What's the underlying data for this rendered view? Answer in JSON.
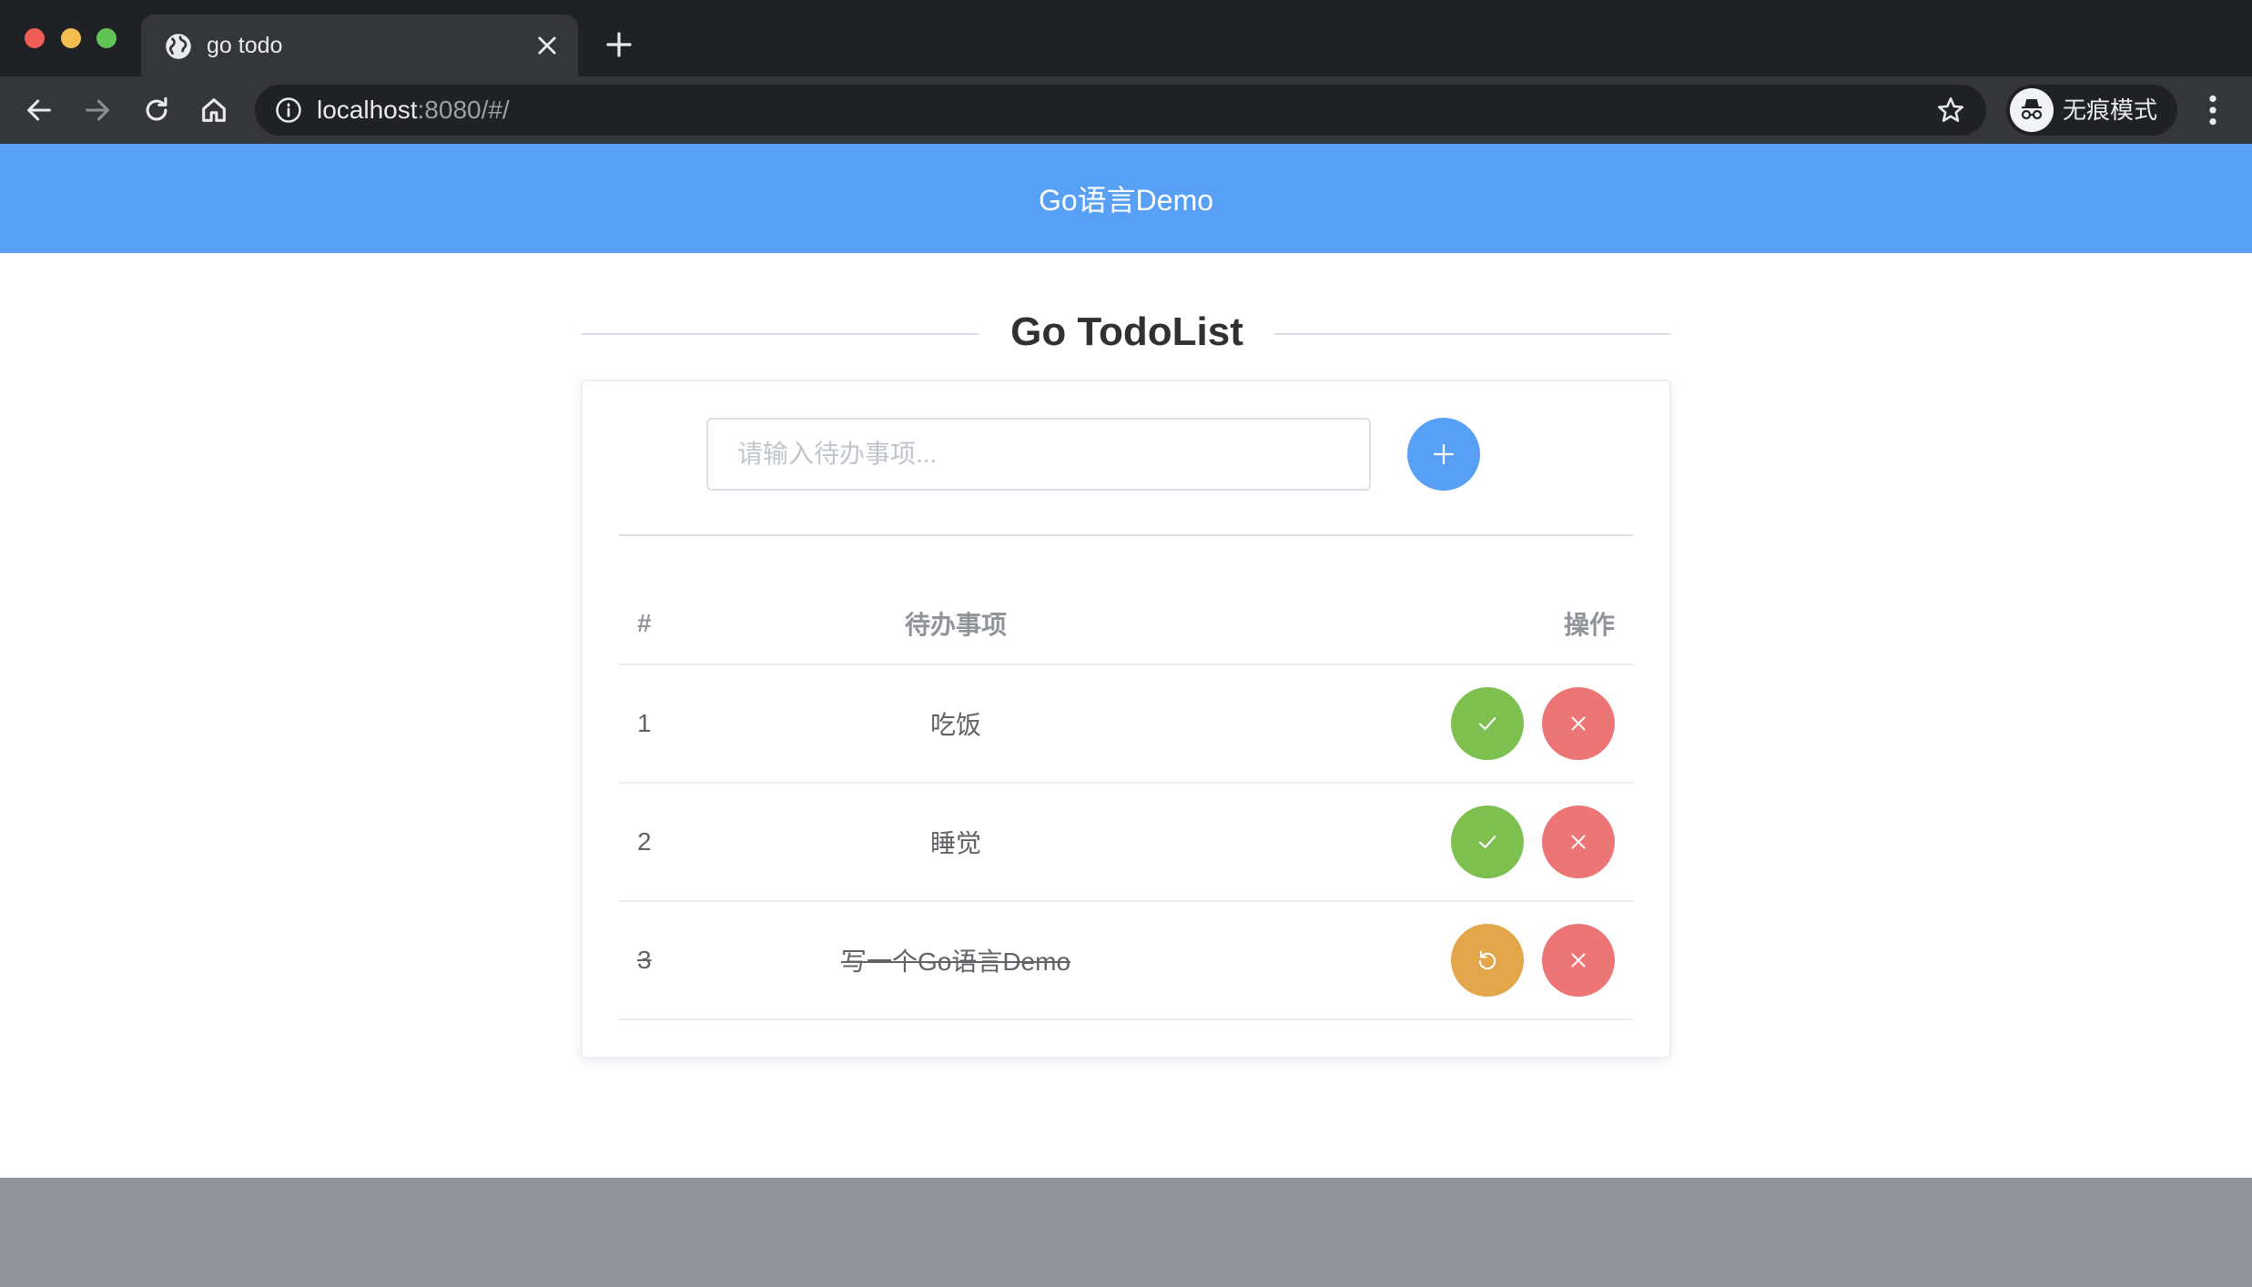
{
  "browser": {
    "tab_title": "go todo",
    "url_host": "localhost",
    "url_rest": ":8080/#/",
    "profile_label": "无痕模式"
  },
  "app": {
    "header_title": "Go语言Demo",
    "page_title": "Go TodoList"
  },
  "todo_form": {
    "placeholder": "请输入待办事项..."
  },
  "table": {
    "headers": {
      "index": "#",
      "item": "待办事项",
      "actions": "操作"
    },
    "rows": [
      {
        "index": "1",
        "title": "吃饭",
        "done": false
      },
      {
        "index": "2",
        "title": "睡觉",
        "done": false
      },
      {
        "index": "3",
        "title": "写一个Go语言Demo",
        "done": true
      }
    ]
  },
  "colors": {
    "header_blue": "#58a0f6",
    "success": "#7ec050",
    "danger": "#ec7676",
    "warning": "#e4a64a"
  },
  "icons": {
    "add": "plus-icon",
    "complete": "check-icon",
    "delete": "close-icon",
    "undo": "refresh-icon"
  }
}
